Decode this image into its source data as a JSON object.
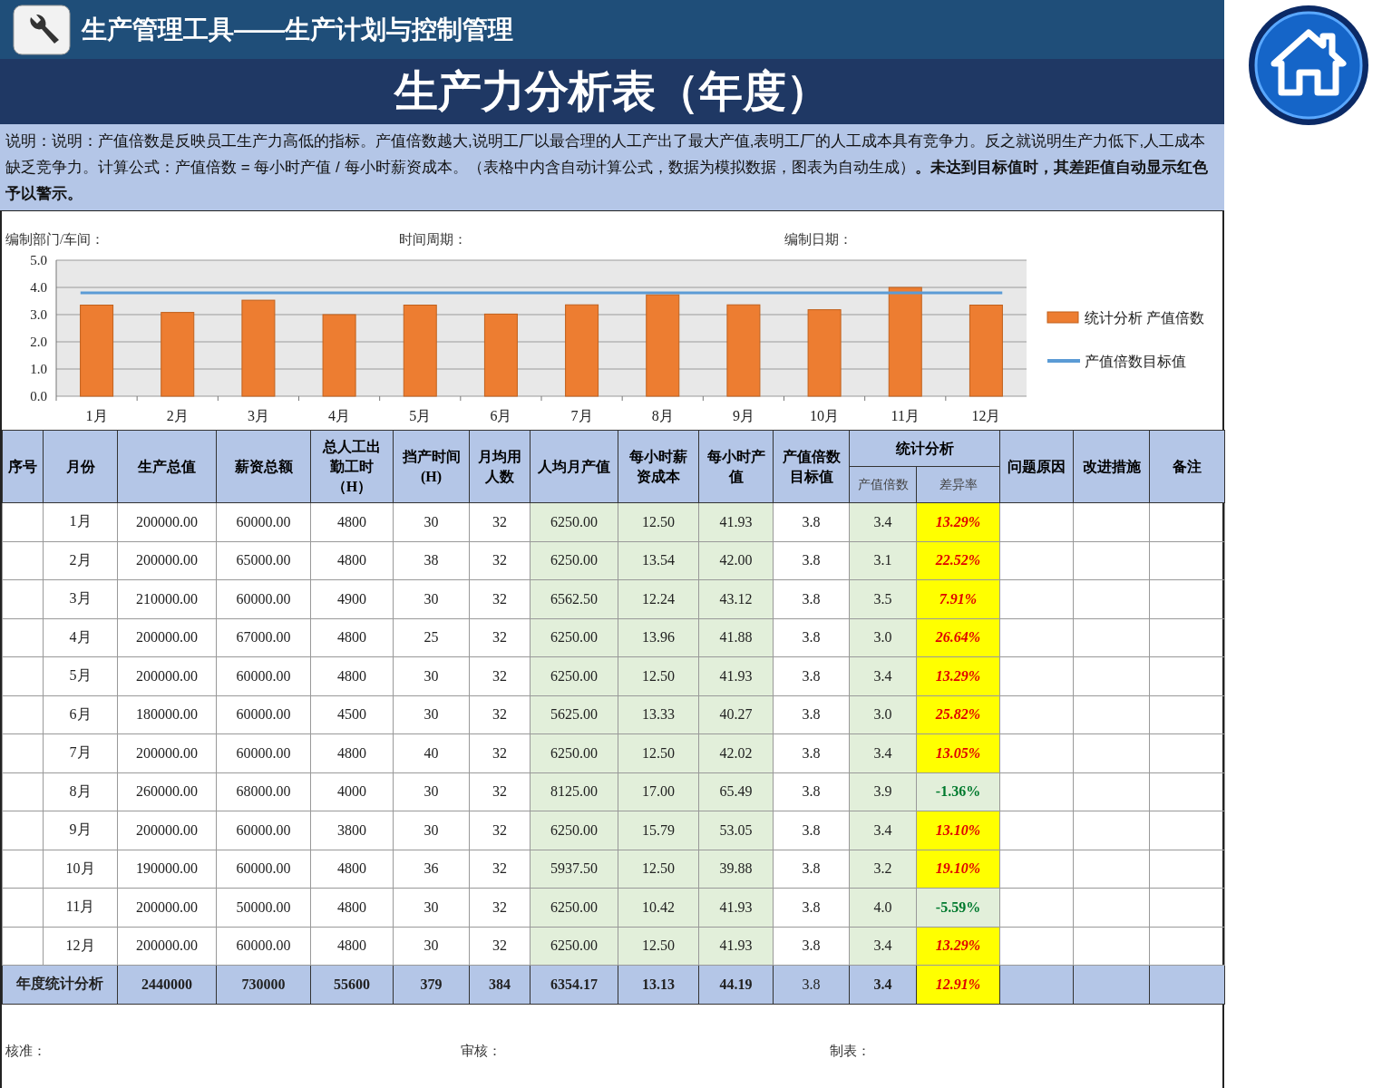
{
  "header": {
    "title": "生产管理工具——生产计划与控制管理"
  },
  "report_title": "生产力分析表（年度）",
  "description": "说明：说明：产值倍数是反映员工生产力高低的指标。产值倍数越大,说明工厂以最合理的人工产出了最大产值,表明工厂的人工成本具有竞争力。反之就说明生产力低下,人工成本缺乏竞争力。计算公式：产值倍数 = 每小时产值 / 每小时薪资成本。（表格中内含自动计算公式，数据为模拟数据，图表为自动生成）**。未达到目标值时，其差距值自动显示红色予以警示。**",
  "meta_fields": [
    "编制部门/车间：",
    "时间周期：",
    "编制日期："
  ],
  "chart": {
    "chart_data": {
      "type": "bar",
      "categories": [
        "1月",
        "2月",
        "3月",
        "4月",
        "5月",
        "6月",
        "7月",
        "8月",
        "9月",
        "10月",
        "11月",
        "12月"
      ],
      "ylim": [
        0,
        5
      ],
      "yticks": [
        {
          "value": 0,
          "label": "0.0"
        },
        {
          "value": 1,
          "label": "1.0"
        },
        {
          "value": 2,
          "label": "2.0"
        },
        {
          "value": 3,
          "label": "3.0"
        },
        {
          "value": 4,
          "label": "4.0"
        },
        {
          "value": 5,
          "label": "5.0"
        }
      ],
      "series": [
        {
          "name": "统计分析 产值倍数",
          "color": "#ed7d31",
          "values": [
            3.35,
            3.08,
            3.53,
            3.0,
            3.35,
            3.02,
            3.36,
            3.73,
            3.36,
            3.18,
            4.0,
            3.35
          ]
        }
      ],
      "ref_lines": [
        {
          "axis": "y",
          "value": 3.8,
          "label": "产值倍数目标值",
          "color": "#5b9bd5"
        }
      ],
      "grid": true,
      "legend": true
    }
  },
  "table": {
    "columns": [
      {
        "label": "序号"
      },
      {
        "label": "月份"
      },
      {
        "label": "生产总值"
      },
      {
        "label": "薪资总额"
      },
      {
        "label": "总人工出勤工时（H）"
      },
      {
        "label": "挡产时间(H)"
      },
      {
        "label": "月均用人数"
      },
      {
        "label": "人均月产值"
      },
      {
        "label": "每小时薪资成本"
      },
      {
        "label": "每小时产值"
      },
      {
        "label": "产值倍数目标值"
      },
      {
        "label": "统计分析",
        "children": [
          {
            "label": "产值倍数"
          },
          {
            "label": "差异率"
          }
        ]
      },
      {
        "label": "问题原因"
      },
      {
        "label": "改进措施"
      },
      {
        "label": "备注"
      }
    ],
    "rows": [
      {
        "month": "1月",
        "output": "200000.00",
        "salary": "60000.00",
        "hours": "4800",
        "time": "30",
        "people": "32",
        "per_capita": "6250.00",
        "hourly_cost": "12.50",
        "hourly_value": "41.93",
        "target": "3.8",
        "ratio": "3.4",
        "diff": "13.29%",
        "below_target": true
      },
      {
        "month": "2月",
        "output": "200000.00",
        "salary": "65000.00",
        "hours": "4800",
        "time": "38",
        "people": "32",
        "per_capita": "6250.00",
        "hourly_cost": "13.54",
        "hourly_value": "42.00",
        "target": "3.8",
        "ratio": "3.1",
        "diff": "22.52%",
        "below_target": true
      },
      {
        "month": "3月",
        "output": "210000.00",
        "salary": "60000.00",
        "hours": "4900",
        "time": "30",
        "people": "32",
        "per_capita": "6562.50",
        "hourly_cost": "12.24",
        "hourly_value": "43.12",
        "target": "3.8",
        "ratio": "3.5",
        "diff": "7.91%",
        "below_target": true
      },
      {
        "month": "4月",
        "output": "200000.00",
        "salary": "67000.00",
        "hours": "4800",
        "time": "25",
        "people": "32",
        "per_capita": "6250.00",
        "hourly_cost": "13.96",
        "hourly_value": "41.88",
        "target": "3.8",
        "ratio": "3.0",
        "diff": "26.64%",
        "below_target": true
      },
      {
        "month": "5月",
        "output": "200000.00",
        "salary": "60000.00",
        "hours": "4800",
        "time": "30",
        "people": "32",
        "per_capita": "6250.00",
        "hourly_cost": "12.50",
        "hourly_value": "41.93",
        "target": "3.8",
        "ratio": "3.4",
        "diff": "13.29%",
        "below_target": true
      },
      {
        "month": "6月",
        "output": "180000.00",
        "salary": "60000.00",
        "hours": "4500",
        "time": "30",
        "people": "32",
        "per_capita": "5625.00",
        "hourly_cost": "13.33",
        "hourly_value": "40.27",
        "target": "3.8",
        "ratio": "3.0",
        "diff": "25.82%",
        "below_target": true
      },
      {
        "month": "7月",
        "output": "200000.00",
        "salary": "60000.00",
        "hours": "4800",
        "time": "40",
        "people": "32",
        "per_capita": "6250.00",
        "hourly_cost": "12.50",
        "hourly_value": "42.02",
        "target": "3.8",
        "ratio": "3.4",
        "diff": "13.05%",
        "below_target": true
      },
      {
        "month": "8月",
        "output": "260000.00",
        "salary": "68000.00",
        "hours": "4000",
        "time": "30",
        "people": "32",
        "per_capita": "8125.00",
        "hourly_cost": "17.00",
        "hourly_value": "65.49",
        "target": "3.8",
        "ratio": "3.9",
        "diff": "-1.36%",
        "below_target": false
      },
      {
        "month": "9月",
        "output": "200000.00",
        "salary": "60000.00",
        "hours": "3800",
        "time": "30",
        "people": "32",
        "per_capita": "6250.00",
        "hourly_cost": "15.79",
        "hourly_value": "53.05",
        "target": "3.8",
        "ratio": "3.4",
        "diff": "13.10%",
        "below_target": true
      },
      {
        "month": "10月",
        "output": "190000.00",
        "salary": "60000.00",
        "hours": "4800",
        "time": "36",
        "people": "32",
        "per_capita": "5937.50",
        "hourly_cost": "12.50",
        "hourly_value": "39.88",
        "target": "3.8",
        "ratio": "3.2",
        "diff": "19.10%",
        "below_target": true
      },
      {
        "month": "11月",
        "output": "200000.00",
        "salary": "50000.00",
        "hours": "4800",
        "time": "30",
        "people": "32",
        "per_capita": "6250.00",
        "hourly_cost": "10.42",
        "hourly_value": "41.93",
        "target": "3.8",
        "ratio": "4.0",
        "diff": "-5.59%",
        "below_target": false
      },
      {
        "month": "12月",
        "output": "200000.00",
        "salary": "60000.00",
        "hours": "4800",
        "time": "30",
        "people": "32",
        "per_capita": "6250.00",
        "hourly_cost": "12.50",
        "hourly_value": "41.93",
        "target": "3.8",
        "ratio": "3.4",
        "diff": "13.29%",
        "below_target": true
      }
    ],
    "total": {
      "label": "年度统计分析",
      "output": "2440000",
      "salary": "730000",
      "hours": "55600",
      "time": "379",
      "people": "384",
      "per_capita": "6354.17",
      "hourly_cost": "13.13",
      "hourly_value": "44.19",
      "target": "3.8",
      "ratio": "3.4",
      "diff": "12.91%",
      "below_target": true
    }
  },
  "footer_fields": [
    "核准：",
    "审核：",
    "制表："
  ]
}
